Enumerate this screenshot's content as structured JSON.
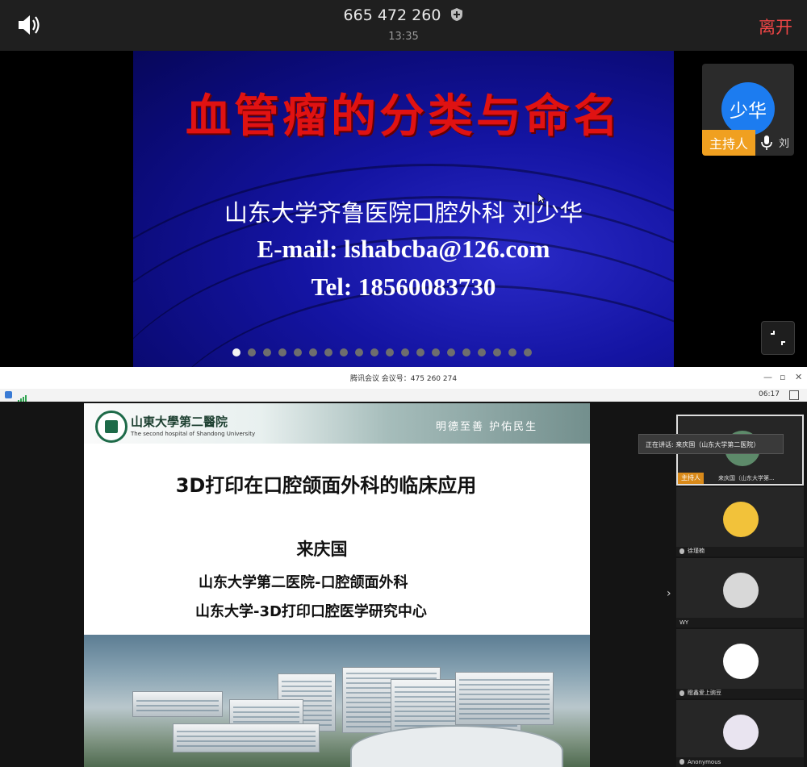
{
  "top_bar": {
    "meeting_id": "665 472 260",
    "time": "13:35",
    "leave_label": "离开",
    "speaker_icon": "speaker-icon",
    "shield_icon": "shield-icon"
  },
  "shared_slide_1": {
    "title": "血管瘤的分类与命名",
    "author_line": "山东大学齐鲁医院口腔外科 刘少华",
    "email_line": "E-mail: lshabcba@126.com",
    "tel_line": "Tel:  18560083730",
    "page_count": 20,
    "current_page": 1
  },
  "host_tile_1": {
    "avatar_text": "少华",
    "host_badge": "主持人",
    "name": "刘"
  },
  "desktop_window": {
    "title": "腾讯会议 会议号：475 260 274",
    "duration": "06:17",
    "min_icon": "minimize-icon",
    "max_icon": "maximize-icon",
    "close_icon": "close-icon"
  },
  "shared_slide_2": {
    "hospital_name_cn": "山東大學第二醫院",
    "hospital_name_en": "The second hospital of Shandong University",
    "motto": "明德至善  护佑民生",
    "title": "3D打印在口腔颌面外科的临床应用",
    "author": "来庆国",
    "affiliation_1": "山东大学第二医院-口腔颌面外科",
    "affiliation_2": "山东大学-3D打印口腔医学研究中心"
  },
  "participants_panel": {
    "speaking_tip": "正在讲话: 来庆国（山东大学第二医院）",
    "host_badge": "主持人",
    "participants": [
      {
        "name": "来庆国（山东大学第...",
        "avatar_color": "#5d8a6a"
      },
      {
        "name": "徐瑾楠",
        "avatar_color": "#f2c23a"
      },
      {
        "name": "WY",
        "avatar_color": "#d8d8d8"
      },
      {
        "name": "瞪鑫爱上豌豆",
        "avatar_color": "#ffffff"
      },
      {
        "name": "Anonymous",
        "avatar_color": "#e9e4f0"
      }
    ]
  }
}
